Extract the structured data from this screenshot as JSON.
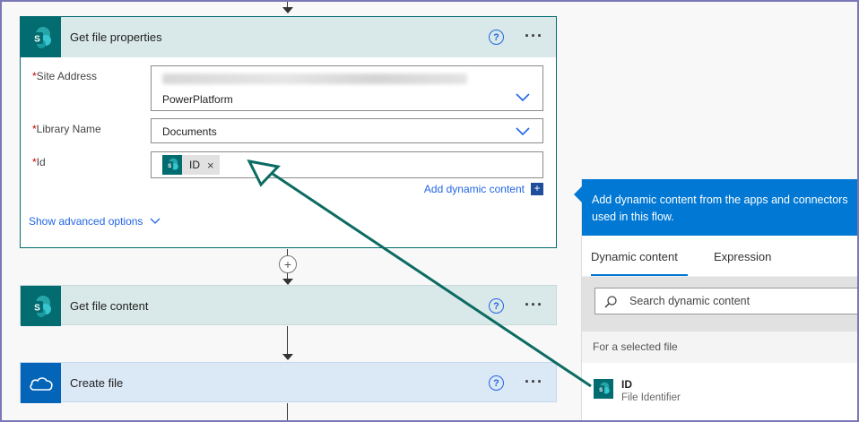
{
  "cards": {
    "get_file_properties": {
      "title": "Get file properties",
      "fields": {
        "site_address": {
          "label": "Site Address",
          "value": "PowerPlatform"
        },
        "library_name": {
          "label": "Library Name",
          "value": "Documents"
        },
        "id": {
          "label": "Id",
          "token": "ID"
        }
      },
      "add_dynamic": "Add dynamic content",
      "advanced": "Show advanced options"
    },
    "get_file_content": {
      "title": "Get file content"
    },
    "create_file": {
      "title": "Create file"
    }
  },
  "common": {
    "required_mark": "*",
    "help_glyph": "?",
    "more_glyph": "···",
    "token_remove": "×"
  },
  "panel": {
    "banner": [
      "Add dynamic content from the apps and connectors",
      "used in this flow."
    ],
    "tabs": [
      "Dynamic content",
      "Expression"
    ],
    "search_placeholder": "Search dynamic content",
    "section": "For a selected file",
    "item": {
      "title": "ID",
      "subtitle": "File Identifier"
    }
  },
  "colors": {
    "sharepoint": "#036c70",
    "onedrive": "#0364b8",
    "accent": "#0078d4",
    "annotation_arrow": "#0b6b63"
  }
}
